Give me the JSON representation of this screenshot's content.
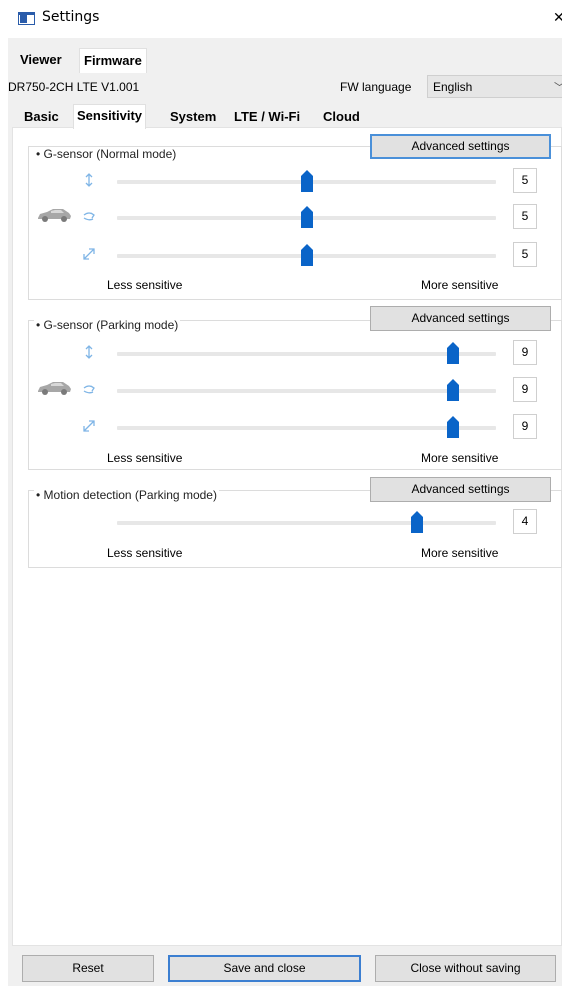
{
  "window": {
    "title": "Settings",
    "close_glyph": "×",
    "icon": "settings-window-icon"
  },
  "top_tabs": [
    {
      "label": "Viewer",
      "active": false
    },
    {
      "label": "Firmware",
      "active": true
    }
  ],
  "firmware": {
    "model": "DR750-2CH LTE  V1.001",
    "fw_language_label": "FW language",
    "fw_language_value": "English"
  },
  "sub_tabs": [
    {
      "label": "Basic",
      "active": false
    },
    {
      "label": "Sensitivity",
      "active": true
    },
    {
      "label": "System",
      "active": false
    },
    {
      "label": "LTE / Wi-Fi",
      "active": false
    },
    {
      "label": "Cloud",
      "active": false
    }
  ],
  "groups": {
    "normal": {
      "title": "• G-sensor (Normal mode)",
      "advanced_label": "Advanced settings",
      "sliders": [
        {
          "axis": "vertical-axis-icon",
          "value": 5,
          "max": 10
        },
        {
          "axis": "turn-axis-icon",
          "value": 5,
          "max": 10
        },
        {
          "axis": "diagonal-axis-icon",
          "value": 5,
          "max": 10
        }
      ],
      "less_label": "Less sensitive",
      "more_label": "More sensitive"
    },
    "parking": {
      "title": "• G-sensor (Parking mode)",
      "advanced_label": "Advanced settings",
      "sliders": [
        {
          "axis": "vertical-axis-icon",
          "value": 9,
          "max": 10
        },
        {
          "axis": "turn-axis-icon",
          "value": 9,
          "max": 10
        },
        {
          "axis": "diagonal-axis-icon",
          "value": 9,
          "max": 10
        }
      ],
      "less_label": "Less sensitive",
      "more_label": "More sensitive"
    },
    "motion": {
      "title": "• Motion detection (Parking mode)",
      "advanced_label": "Advanced settings",
      "sliders": [
        {
          "value": 4,
          "max": 5
        }
      ],
      "less_label": "Less sensitive",
      "more_label": "More sensitive"
    }
  },
  "buttons": {
    "reset": "Reset",
    "save_close": "Save and close",
    "close_no_save": "Close without saving"
  },
  "colors": {
    "accent": "#0a64c8",
    "arrow": "#7fb5e6",
    "focus_border": "#3c7fd1"
  }
}
